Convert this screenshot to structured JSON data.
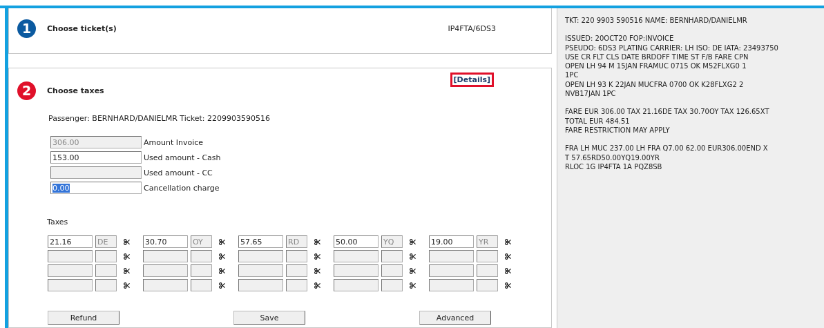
{
  "steps": [
    {
      "number": "1",
      "title": "Choose ticket(s)",
      "color": "#0b5aa0",
      "reference": "IP4FTA/6DS3"
    },
    {
      "number": "2",
      "title": "Choose taxes",
      "color": "#e0102a",
      "link": "[Details]"
    }
  ],
  "passenger": "Passenger: BERNHARD/DANIELMR Ticket: 2209903590516",
  "amounts": [
    {
      "value": "306.00",
      "label": "Amount Invoice",
      "disabled": true
    },
    {
      "value": "153.00",
      "label": "Used amount - Cash",
      "disabled": false
    },
    {
      "label": "Used amount - CC",
      "disabled": true
    },
    {
      "value": "0.00",
      "label": "Cancellation charge",
      "disabled": false,
      "value_selected": true
    }
  ],
  "taxes": {
    "label": "Taxes",
    "rows": [
      {
        "cells": [
          {
            "amount": "21.16",
            "code": "DE",
            "disabled": false
          },
          {
            "amount": "30.70",
            "code": "OY",
            "disabled": false
          },
          {
            "amount": "57.65",
            "code": "RD",
            "disabled": false
          },
          {
            "amount": "50.00",
            "code": "YQ",
            "disabled": false
          },
          {
            "amount": "19.00",
            "code": "YR",
            "disabled": false
          }
        ]
      },
      {
        "cells": [
          {
            "disabled": true
          },
          {
            "disabled": true
          },
          {
            "disabled": true
          },
          {
            "disabled": true
          },
          {
            "disabled": true
          }
        ]
      },
      {
        "cells": [
          {
            "disabled": true
          },
          {
            "disabled": true
          },
          {
            "disabled": true
          },
          {
            "disabled": true
          },
          {
            "disabled": true
          }
        ]
      },
      {
        "cells": [
          {
            "disabled": true
          },
          {
            "disabled": true
          },
          {
            "disabled": true
          },
          {
            "disabled": true
          },
          {
            "disabled": true
          }
        ]
      }
    ]
  },
  "buttons": [
    "Refund",
    "Save",
    "Advanced"
  ],
  "ticket_text": [
    [
      "TKT: 220 9903 590516 NAME: BERNHARD/DANIELMR"
    ],
    [
      "ISSUED: 20OCT20 FOP:INVOICE",
      "PSEUDO: 6DS3 PLATING CARRIER: LH ISO: DE IATA: 23493750",
      "USE CR FLT CLS DATE BRDOFF TIME ST F/B FARE CPN",
      "OPEN LH 94 M 15JAN FRAMUC 0715 OK M52FLXG0 1",
      "1PC",
      "OPEN LH 93 K 22JAN MUCFRA 0700 OK K28FLXG2 2",
      "NVB17JAN 1PC"
    ],
    [
      "FARE EUR 306.00 TAX 21.16DE TAX 30.70OY TAX 126.65XT",
      "TOTAL EUR 484.51",
      "FARE RESTRICTION MAY APPLY"
    ],
    [
      "FRA LH MUC 237.00 LH FRA Q7.00 62.00 EUR306.00END X",
      "T 57.65RD50.00YQ19.00YR",
      "RLOC 1G IP4FTA 1A PQZ8SB"
    ]
  ]
}
